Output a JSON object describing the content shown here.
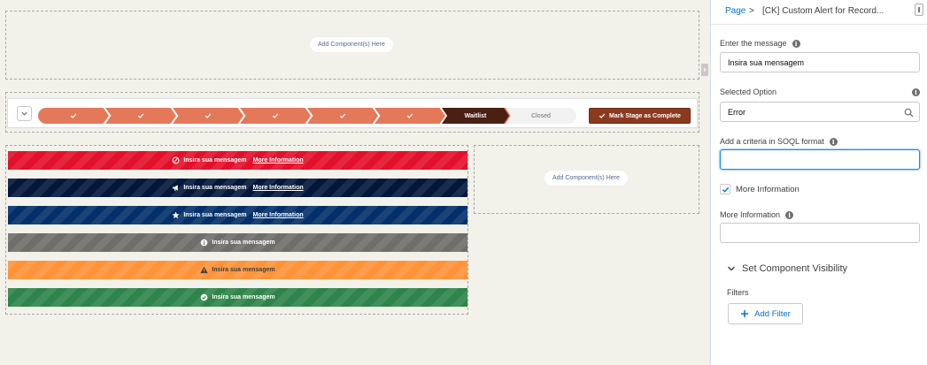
{
  "canvas": {
    "add_component_label": "Add Component(s) Here"
  },
  "path": {
    "complete_stage_count": 7,
    "current_stage": "Waitlist",
    "next_stage": "Closed",
    "mark_complete_label": "Mark Stage as Complete",
    "colors": {
      "complete": "#e4795a",
      "current": "#4a1f14",
      "future": "#f2f2f2",
      "button": "#8c3a1f"
    }
  },
  "alerts": [
    {
      "variant": "error",
      "icon": "ban-icon",
      "message": "Insira sua mensagem",
      "more": "More Information",
      "color": "#e3102b"
    },
    {
      "variant": "announcement",
      "icon": "megaphone-icon",
      "message": "Insira sua mensagem",
      "more": "More Information",
      "color": "#03173a"
    },
    {
      "variant": "featured",
      "icon": "star-icon",
      "message": "Insira sua mensagem",
      "more": "More Information",
      "color": "#03306a"
    },
    {
      "variant": "info",
      "icon": "info-icon",
      "message": "Insira sua mensagem",
      "more": "",
      "color": "#706e6b"
    },
    {
      "variant": "warning",
      "icon": "warning-icon",
      "message": "Insira sua mensagem",
      "more": "",
      "color": "#fe9339"
    },
    {
      "variant": "success",
      "icon": "check-circle-icon",
      "message": "Insira sua mensagem",
      "more": "",
      "color": "#2e844a"
    }
  ],
  "panel": {
    "breadcrumb_page": "Page",
    "breadcrumb_sep": ">",
    "breadcrumb_title": "[CK] Custom Alert for Record...",
    "message_label": "Enter the message",
    "message_value": "Insira sua mensagem",
    "option_label": "Selected Option",
    "option_value": "Error",
    "criteria_label": "Add a criteria in SOQL format",
    "criteria_value": "",
    "more_info_checkbox_label": "More Information",
    "more_info_checked": true,
    "more_info_label": "More Information",
    "more_info_value": "",
    "visibility_section": "Set Component Visibility",
    "filters_label": "Filters",
    "add_filter_label": "Add Filter"
  }
}
